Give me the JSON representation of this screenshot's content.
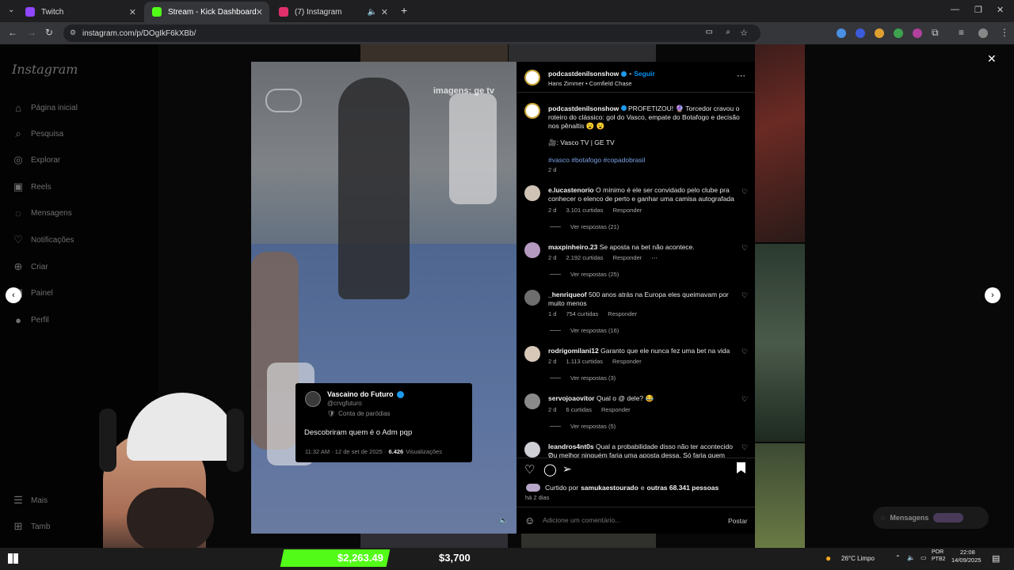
{
  "browser": {
    "tabs": [
      {
        "label": "Twitch",
        "active": false,
        "favicon_color": "#9146ff"
      },
      {
        "label": "Stream - Kick Dashboard",
        "active": true,
        "favicon_color": "#53fc18"
      },
      {
        "label": "(7) Instagram",
        "active": false,
        "favicon_color": "#e1306c"
      }
    ],
    "url": "instagram.com/p/DOgIkF6kXBb/"
  },
  "sidebar": {
    "logo": "Instagram",
    "items": [
      {
        "label": "Página inicial",
        "icon": "home-icon"
      },
      {
        "label": "Pesquisa",
        "icon": "search-icon"
      },
      {
        "label": "Explorar",
        "icon": "compass-icon"
      },
      {
        "label": "Reels",
        "icon": "reels-icon"
      },
      {
        "label": "Mensagens",
        "icon": "messenger-icon"
      },
      {
        "label": "Notificações",
        "icon": "heart-icon"
      },
      {
        "label": "Criar",
        "icon": "plus-icon"
      },
      {
        "label": "Painel",
        "icon": "dashboard-icon"
      },
      {
        "label": "Perfil",
        "icon": "profile-icon"
      }
    ],
    "more_label": "Mais",
    "also_label": "Tamb"
  },
  "video": {
    "watermark": "imagens: ge tv",
    "tweet": {
      "name": "Vascaino do Futuro",
      "handle": "@crvgfuturo",
      "tag": "Conta de paródias",
      "text": "Descobriram quem é o Adm pqp",
      "time": "11:32 AM · 12 de set de 2025 ·",
      "views_count": "6.426",
      "views_label": "Visualizações"
    }
  },
  "post": {
    "author": "podcastdenilsonshow",
    "follow_label": "Seguir",
    "audio": "Hans Zimmer • Cornfield Chase",
    "caption_line1": "PROFETIZOU! 🔮 Torcedor cravou o",
    "caption_line2": "roteiro do clássico: gol do Vasco, empate do Botafogo e decisão",
    "caption_line3": "nos pênaltis 😮 😮",
    "credits": "🎥: Vasco TV | GE TV",
    "hashtags": "#vasco #botafogo #copadobrasil",
    "age": "2 d",
    "liked_by_prefix": "Curtido por",
    "liked_by_user": "samukaestourado",
    "liked_by_suffix": "e",
    "liked_by_others": "outras 68.341 pessoas",
    "date": "há 2 dias",
    "comment_placeholder": "Adicione um comentário...",
    "post_button": "Postar"
  },
  "comments": [
    {
      "user": "e.lucastenorio",
      "line1": "O mínimo é ele ser convidado pelo clube pra",
      "line2": "conhecer o elenco de perto e ganhar uma camisa autografada",
      "age": "2 d",
      "likes": "3.101 curtidas",
      "reply": "Responder",
      "replies": "Ver respostas (21)"
    },
    {
      "user": "maxpinheiro.23",
      "line1": "Se aposta na bet não acontece.",
      "line2": "",
      "age": "2 d",
      "likes": "2.192 curtidas",
      "reply": "Responder",
      "replies": "Ver respostas (25)"
    },
    {
      "user": "_henriqueof",
      "line1": "500 anos atrás na Europa eles queimavam por",
      "line2": "muito menos",
      "age": "1 d",
      "likes": "754 curtidas",
      "reply": "Responder",
      "replies": "Ver respostas (16)"
    },
    {
      "user": "rodrigomilani12",
      "line1": "Garanto que ele nunca fez uma bet na vida",
      "line2": "",
      "age": "2 d",
      "likes": "1.113 curtidas",
      "reply": "Responder",
      "replies": "Ver respostas (3)"
    },
    {
      "user": "servojoaovitor",
      "line1": "Qual o @ dele? 😂",
      "line2": "",
      "age": "2 d",
      "likes": "6 curtidas",
      "reply": "Responder",
      "replies": "Ver respostas (5)"
    },
    {
      "user": "leandros4nt0s",
      "line1": "Qual a probabilidade disso não ter acontecido ?",
      "line2": "Ou melhor ninguém faria uma aposta dessa. Só faria quem",
      "age": "",
      "likes": "",
      "reply": "",
      "replies": ""
    }
  ],
  "messages_float": "Mensagens",
  "stream_overlay": {
    "amount1": "$2,263.49",
    "amount2": "$3,700"
  },
  "taskbar": {
    "weather": "26°C  Limpo",
    "lang1": "POR",
    "lang2": "PTB2",
    "time": "22:08",
    "date": "14/09/2025"
  },
  "colors": {
    "accent": "#0095f6",
    "verified": "#1d9bf0",
    "money_bar": "#53fc18"
  }
}
